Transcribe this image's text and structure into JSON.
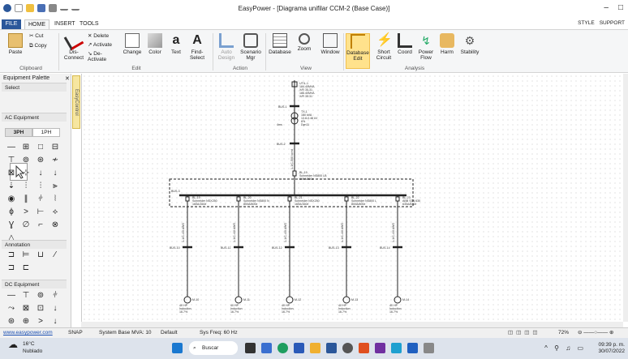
{
  "window": {
    "title": "EasyPower - [Diagrama unifilar CCM-2 (Base Case)]",
    "minimize": "–",
    "restore": "□"
  },
  "menu": {
    "tabs": [
      "FILE",
      "HOME",
      "INSERT",
      "TOOLS"
    ],
    "right": [
      "STYLE",
      "SUPPORT"
    ]
  },
  "ribbon": {
    "clipboard": {
      "paste": "Paste",
      "cut": "Cut",
      "copy": "Copy",
      "group": "Clipboard"
    },
    "edit": {
      "disconnect": "Dis-Connect",
      "delete": "Delete",
      "activate": "Activate",
      "deactivate": "De-Activate",
      "change": "Change",
      "color": "Color",
      "text": "Text",
      "find": "Find-Select",
      "group": "Edit"
    },
    "action": {
      "auto_design": "Auto Design",
      "scenario": "Scenario Mgr",
      "group": "Action"
    },
    "view": {
      "database": "Database",
      "zoom": "Zoom",
      "window": "Window",
      "group": "View"
    },
    "analysis": {
      "database_edit": "Database Edit",
      "short_circuit": "Short Circuit",
      "coord": "Coord",
      "power_flow": "Power Flow",
      "harm": "Harm",
      "stability": "Stability",
      "group": "Analysis"
    }
  },
  "palette": {
    "title": "Equipment Palette",
    "pin": "✕",
    "select_section": "Select",
    "ac_section": "AC Equipment",
    "phase_3": "3PH",
    "phase_1": "1PH",
    "annotation_section": "Annotation",
    "dc_section": "DC Equipment",
    "side_tab": "EasyControl"
  },
  "diagram": {
    "util_name": "UTIL-1",
    "util_info": [
      "184.40MVA",
      "X/R 35.31",
      "186.40MVA",
      "X/R 35.31"
    ],
    "bus1": "BUS-1",
    "tx_name": "TX-1",
    "tx_info": [
      "150 kVA",
      "13.8-0.48 kV",
      "6%",
      "Dyn11"
    ],
    "tx_tag": "4ms",
    "bus2": "BUS-2",
    "main_breaker": "BL-19",
    "main_breaker_info": [
      "Schneider NS800 LB",
      "800A/800e"
    ],
    "cable_main": "1-1/C-500 kcmil",
    "ccm_bus": "BUS-3",
    "feeders": [
      {
        "breaker": "BL-19",
        "info": [
          "Schneider NSX250",
          "160A/160e"
        ],
        "cable": "1-1/C-4/0 AWG",
        "bus": "BUS-10",
        "motor": "M-10",
        "motor_info": [
          "40 HP",
          "Induction",
          "16.7%"
        ]
      },
      {
        "breaker": "BL-20",
        "info": [
          "Schneider NS800 N",
          "800A/800e"
        ],
        "cable": "1-1/C-4/0 AWG",
        "bus": "BUS-11",
        "motor": "M-11",
        "motor_info": [
          "40 HP",
          "Induction",
          "16.7%"
        ]
      },
      {
        "breaker": "BL-21",
        "info": [
          "Schneider NSX250",
          "160A/160e"
        ],
        "cable": "1-1/C-4/0 AWG",
        "bus": "BUS-12",
        "motor": "M-12",
        "motor_info": [
          "40 HP",
          "Induction",
          "16.7%"
        ]
      },
      {
        "breaker": "BL-22",
        "info": [
          "Schneider NS800 L",
          "800A/800e"
        ],
        "cable": "1-1/C-4/0 AWG",
        "bus": "BUS-13",
        "motor": "M-13",
        "motor_info": [
          "40 HP",
          "Induction",
          "16.7%"
        ]
      },
      {
        "breaker": "BL-23",
        "info": [
          "ABB S3N 630",
          "630A/630e"
        ],
        "cable": "1-1/C-4/0 AWG",
        "bus": "BUS-14",
        "motor": "M-14",
        "motor_info": [
          "40 HP",
          "Induction",
          "16.7%"
        ]
      }
    ]
  },
  "status": {
    "link": "www.easypower.com",
    "snap": "SNAP",
    "base_mva": "System Base MVA: 10",
    "default": "Default",
    "sys_freq": "Sys Freq: 60 Hz",
    "zoom": "72%"
  },
  "taskbar": {
    "temp": "16°C",
    "weather": "Nublado",
    "search": "Buscar",
    "time": "09:39 p. m.",
    "date": "30/07/2022"
  },
  "colors": {
    "accent": "#2b579a",
    "selected": "#ffe28c",
    "palette_bg": "#f2f2f2"
  }
}
